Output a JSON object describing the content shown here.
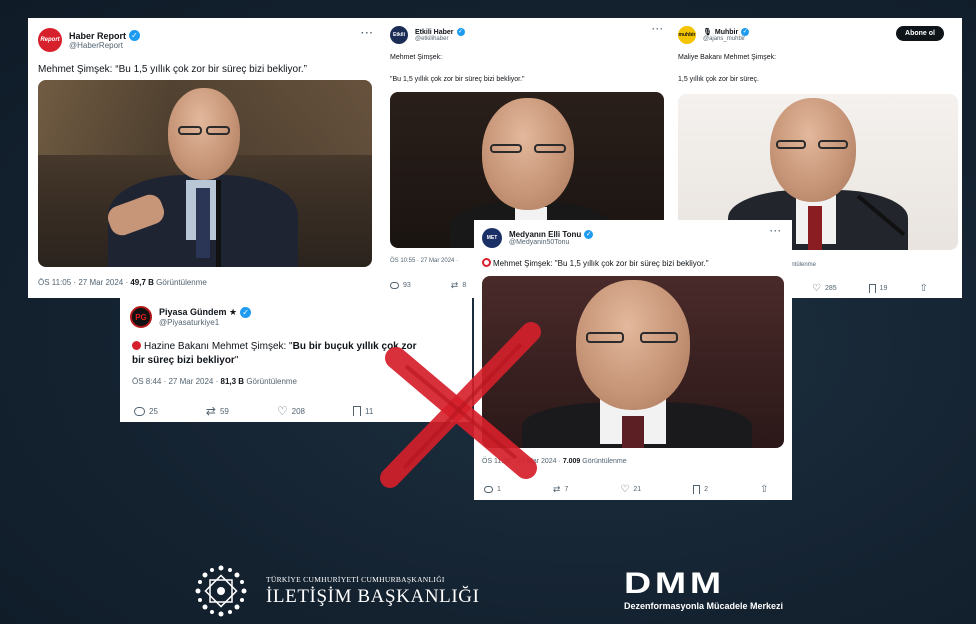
{
  "tweets": {
    "haber_report": {
      "name": "Haber Report",
      "handle": "@HaberReport",
      "avatar_text": "Report",
      "text": "Mehmet Şimşek: “Bu 1,5 yıllık çok zor bir süreç bizi bekliyor.”",
      "time": "ÖS 11:05 · 27 Mar 2024 ·",
      "views": "49,7 B",
      "views_label": "Görüntülenme"
    },
    "etkili_haber": {
      "name": "Etkili Haber",
      "handle": "@etkilihaber",
      "avatar_text": "Etkili",
      "line1": "Mehmet Şimşek:",
      "line2": "\"Bu 1,5 yıllık çok zor bir süreç bizi bekliyor.\"",
      "time": "ÖS 10:55 · 27 Mar 2024 ·",
      "replies": "93",
      "retweets": "8"
    },
    "muhbir": {
      "name": "Muhbir",
      "handle": "@ajans_muhbir",
      "avatar_text": "muhbir",
      "follow_button": "Abone ol",
      "line1": "Maliye Bakanı Mehmet Şimşek:",
      "line2": "1,5 yıllık çok zor bir süreç.",
      "views_label": "üntülenme",
      "likes": "285",
      "bookmarks": "19"
    },
    "piyasa_gundem": {
      "name": "Piyasa Gündem ★",
      "handle": "@Piyasaturkiye1",
      "avatar_text": "PG",
      "text_prefix": "Hazine Bakanı Mehmet Şimşek: \"",
      "text_bold": "Bu bir buçuk yıllık çok zor bir süreç bizi bekliyor",
      "text_suffix": "\"",
      "time": "ÖS 8:44 · 27 Mar 2024 ·",
      "views": "81,3 B",
      "views_label": "Görüntülenme",
      "replies": "25",
      "retweets": "59",
      "likes": "208",
      "bookmarks": "11"
    },
    "medyanin_elli_tonu": {
      "name": "Medyanın Elli Tonu",
      "handle": "@Medyanin50Tonu",
      "avatar_text": "MET",
      "text": "Mehmet Şimşek: \"Bu 1,5 yıllık çok zor bir süreç bizi bekliyor.\"",
      "time": "ÖS 11:16 · 27 Mar 2024 ·",
      "views": "7.009",
      "views_label": "Görüntülenme",
      "replies": "1",
      "retweets": "7",
      "likes": "21",
      "bookmarks": "2"
    }
  },
  "footer": {
    "iletisim_small": "TÜRKİYE CUMHURİYETİ CUMHURBAŞKANLIĞI",
    "iletisim_big": "İLETİŞİM BAŞKANLIĞI",
    "dmm_logo": "DMM",
    "dmm_sub": "Dezenformasyonla Mücadele Merkezi"
  },
  "colors": {
    "background": "#14222f",
    "verified": "#1d9bf0",
    "cross": "#d6202b"
  }
}
